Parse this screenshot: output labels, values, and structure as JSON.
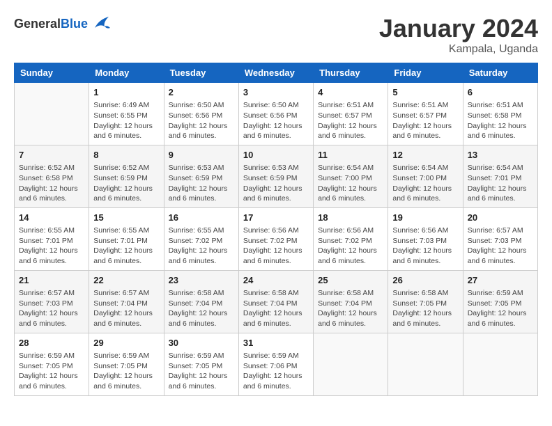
{
  "header": {
    "logo_general": "General",
    "logo_blue": "Blue",
    "month": "January 2024",
    "location": "Kampala, Uganda"
  },
  "days_of_week": [
    "Sunday",
    "Monday",
    "Tuesday",
    "Wednesday",
    "Thursday",
    "Friday",
    "Saturday"
  ],
  "weeks": [
    [
      {
        "day": "",
        "info": ""
      },
      {
        "day": "1",
        "info": "Sunrise: 6:49 AM\nSunset: 6:55 PM\nDaylight: 12 hours\nand 6 minutes."
      },
      {
        "day": "2",
        "info": "Sunrise: 6:50 AM\nSunset: 6:56 PM\nDaylight: 12 hours\nand 6 minutes."
      },
      {
        "day": "3",
        "info": "Sunrise: 6:50 AM\nSunset: 6:56 PM\nDaylight: 12 hours\nand 6 minutes."
      },
      {
        "day": "4",
        "info": "Sunrise: 6:51 AM\nSunset: 6:57 PM\nDaylight: 12 hours\nand 6 minutes."
      },
      {
        "day": "5",
        "info": "Sunrise: 6:51 AM\nSunset: 6:57 PM\nDaylight: 12 hours\nand 6 minutes."
      },
      {
        "day": "6",
        "info": "Sunrise: 6:51 AM\nSunset: 6:58 PM\nDaylight: 12 hours\nand 6 minutes."
      }
    ],
    [
      {
        "day": "7",
        "info": "Sunrise: 6:52 AM\nSunset: 6:58 PM\nDaylight: 12 hours\nand 6 minutes."
      },
      {
        "day": "8",
        "info": "Sunrise: 6:52 AM\nSunset: 6:59 PM\nDaylight: 12 hours\nand 6 minutes."
      },
      {
        "day": "9",
        "info": "Sunrise: 6:53 AM\nSunset: 6:59 PM\nDaylight: 12 hours\nand 6 minutes."
      },
      {
        "day": "10",
        "info": "Sunrise: 6:53 AM\nSunset: 6:59 PM\nDaylight: 12 hours\nand 6 minutes."
      },
      {
        "day": "11",
        "info": "Sunrise: 6:54 AM\nSunset: 7:00 PM\nDaylight: 12 hours\nand 6 minutes."
      },
      {
        "day": "12",
        "info": "Sunrise: 6:54 AM\nSunset: 7:00 PM\nDaylight: 12 hours\nand 6 minutes."
      },
      {
        "day": "13",
        "info": "Sunrise: 6:54 AM\nSunset: 7:01 PM\nDaylight: 12 hours\nand 6 minutes."
      }
    ],
    [
      {
        "day": "14",
        "info": "Sunrise: 6:55 AM\nSunset: 7:01 PM\nDaylight: 12 hours\nand 6 minutes."
      },
      {
        "day": "15",
        "info": "Sunrise: 6:55 AM\nSunset: 7:01 PM\nDaylight: 12 hours\nand 6 minutes."
      },
      {
        "day": "16",
        "info": "Sunrise: 6:55 AM\nSunset: 7:02 PM\nDaylight: 12 hours\nand 6 minutes."
      },
      {
        "day": "17",
        "info": "Sunrise: 6:56 AM\nSunset: 7:02 PM\nDaylight: 12 hours\nand 6 minutes."
      },
      {
        "day": "18",
        "info": "Sunrise: 6:56 AM\nSunset: 7:02 PM\nDaylight: 12 hours\nand 6 minutes."
      },
      {
        "day": "19",
        "info": "Sunrise: 6:56 AM\nSunset: 7:03 PM\nDaylight: 12 hours\nand 6 minutes."
      },
      {
        "day": "20",
        "info": "Sunrise: 6:57 AM\nSunset: 7:03 PM\nDaylight: 12 hours\nand 6 minutes."
      }
    ],
    [
      {
        "day": "21",
        "info": "Sunrise: 6:57 AM\nSunset: 7:03 PM\nDaylight: 12 hours\nand 6 minutes."
      },
      {
        "day": "22",
        "info": "Sunrise: 6:57 AM\nSunset: 7:04 PM\nDaylight: 12 hours\nand 6 minutes."
      },
      {
        "day": "23",
        "info": "Sunrise: 6:58 AM\nSunset: 7:04 PM\nDaylight: 12 hours\nand 6 minutes."
      },
      {
        "day": "24",
        "info": "Sunrise: 6:58 AM\nSunset: 7:04 PM\nDaylight: 12 hours\nand 6 minutes."
      },
      {
        "day": "25",
        "info": "Sunrise: 6:58 AM\nSunset: 7:04 PM\nDaylight: 12 hours\nand 6 minutes."
      },
      {
        "day": "26",
        "info": "Sunrise: 6:58 AM\nSunset: 7:05 PM\nDaylight: 12 hours\nand 6 minutes."
      },
      {
        "day": "27",
        "info": "Sunrise: 6:59 AM\nSunset: 7:05 PM\nDaylight: 12 hours\nand 6 minutes."
      }
    ],
    [
      {
        "day": "28",
        "info": "Sunrise: 6:59 AM\nSunset: 7:05 PM\nDaylight: 12 hours\nand 6 minutes."
      },
      {
        "day": "29",
        "info": "Sunrise: 6:59 AM\nSunset: 7:05 PM\nDaylight: 12 hours\nand 6 minutes."
      },
      {
        "day": "30",
        "info": "Sunrise: 6:59 AM\nSunset: 7:05 PM\nDaylight: 12 hours\nand 6 minutes."
      },
      {
        "day": "31",
        "info": "Sunrise: 6:59 AM\nSunset: 7:06 PM\nDaylight: 12 hours\nand 6 minutes."
      },
      {
        "day": "",
        "info": ""
      },
      {
        "day": "",
        "info": ""
      },
      {
        "day": "",
        "info": ""
      }
    ]
  ]
}
